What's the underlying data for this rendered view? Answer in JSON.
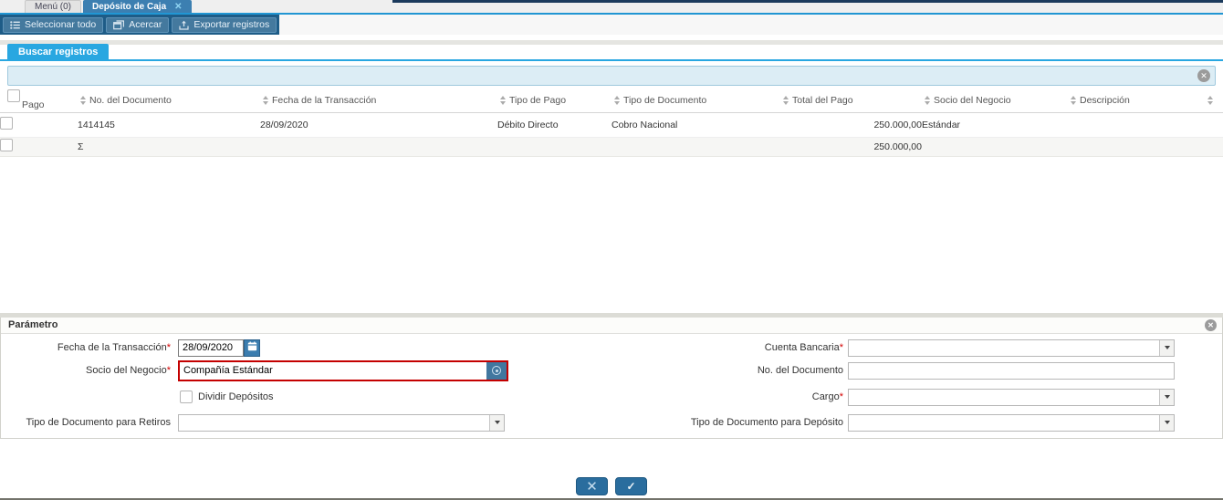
{
  "window": {
    "tabs": [
      {
        "label": "Menú (0)"
      },
      {
        "label": "Depósito de Caja",
        "close_glyph": "✕"
      }
    ]
  },
  "toolbar": {
    "buttons": [
      {
        "label": "Seleccionar todo",
        "icon": "list-icon"
      },
      {
        "label": "Acercar",
        "icon": "window-zoom-icon"
      },
      {
        "label": "Exportar registros",
        "icon": "export-icon"
      }
    ]
  },
  "search": {
    "tab_label": "Buscar registros",
    "input_value": "",
    "clear_glyph": "✕"
  },
  "table": {
    "columns": [
      {
        "label": "Pago"
      },
      {
        "label": "No. del Documento"
      },
      {
        "label": "Fecha de la Transacción"
      },
      {
        "label": "Tipo de Pago"
      },
      {
        "label": "Tipo de Documento"
      },
      {
        "label": "Total del Pago"
      },
      {
        "label": "Socio del Negocio"
      },
      {
        "label": "Descripción"
      }
    ],
    "rows": [
      {
        "documento": "1414145",
        "fecha": "28/09/2020",
        "tipo_pago": "Débito Directo",
        "tipo_documento": "Cobro Nacional",
        "total": "250.000,00",
        "socio": "Estándar",
        "descripcion": ""
      }
    ],
    "sum": {
      "symbol": "Σ",
      "total": "250.000,00"
    }
  },
  "parametro": {
    "title": "Parámetro",
    "collapse_glyph": "✕",
    "left": [
      {
        "label": "Fecha de la Transacción",
        "required": "*",
        "value": "28/09/2020"
      },
      {
        "label": "Socio del Negocio",
        "required": "*",
        "value": "Compañía Estándar"
      },
      {
        "label": "Dividir Depósitos"
      },
      {
        "label": "Tipo de Documento para Retiros",
        "value": ""
      }
    ],
    "right": [
      {
        "label": "Cuenta Bancaria",
        "required": "*",
        "value": ""
      },
      {
        "label": "No. del Documento",
        "value": ""
      },
      {
        "label": "Cargo",
        "required": "*",
        "value": ""
      },
      {
        "label": "Tipo de Documento para Depósito",
        "value": ""
      }
    ]
  },
  "actions": {
    "cancel_glyph": "✕",
    "confirm_glyph": "✓"
  },
  "colors": {
    "accent_blue": "#2196D3",
    "active_tab": "#3C7FB1",
    "toolbar_bg": "#1E5C87",
    "toolbar_button": "#44799E",
    "search_tab": "#29A7E1",
    "search_field_bg": "#DCEDF5",
    "required_red": "#D30000",
    "highlight_border": "#C40000",
    "action_button": "#2A6D9E",
    "top_accent": "#1B3A5C"
  }
}
